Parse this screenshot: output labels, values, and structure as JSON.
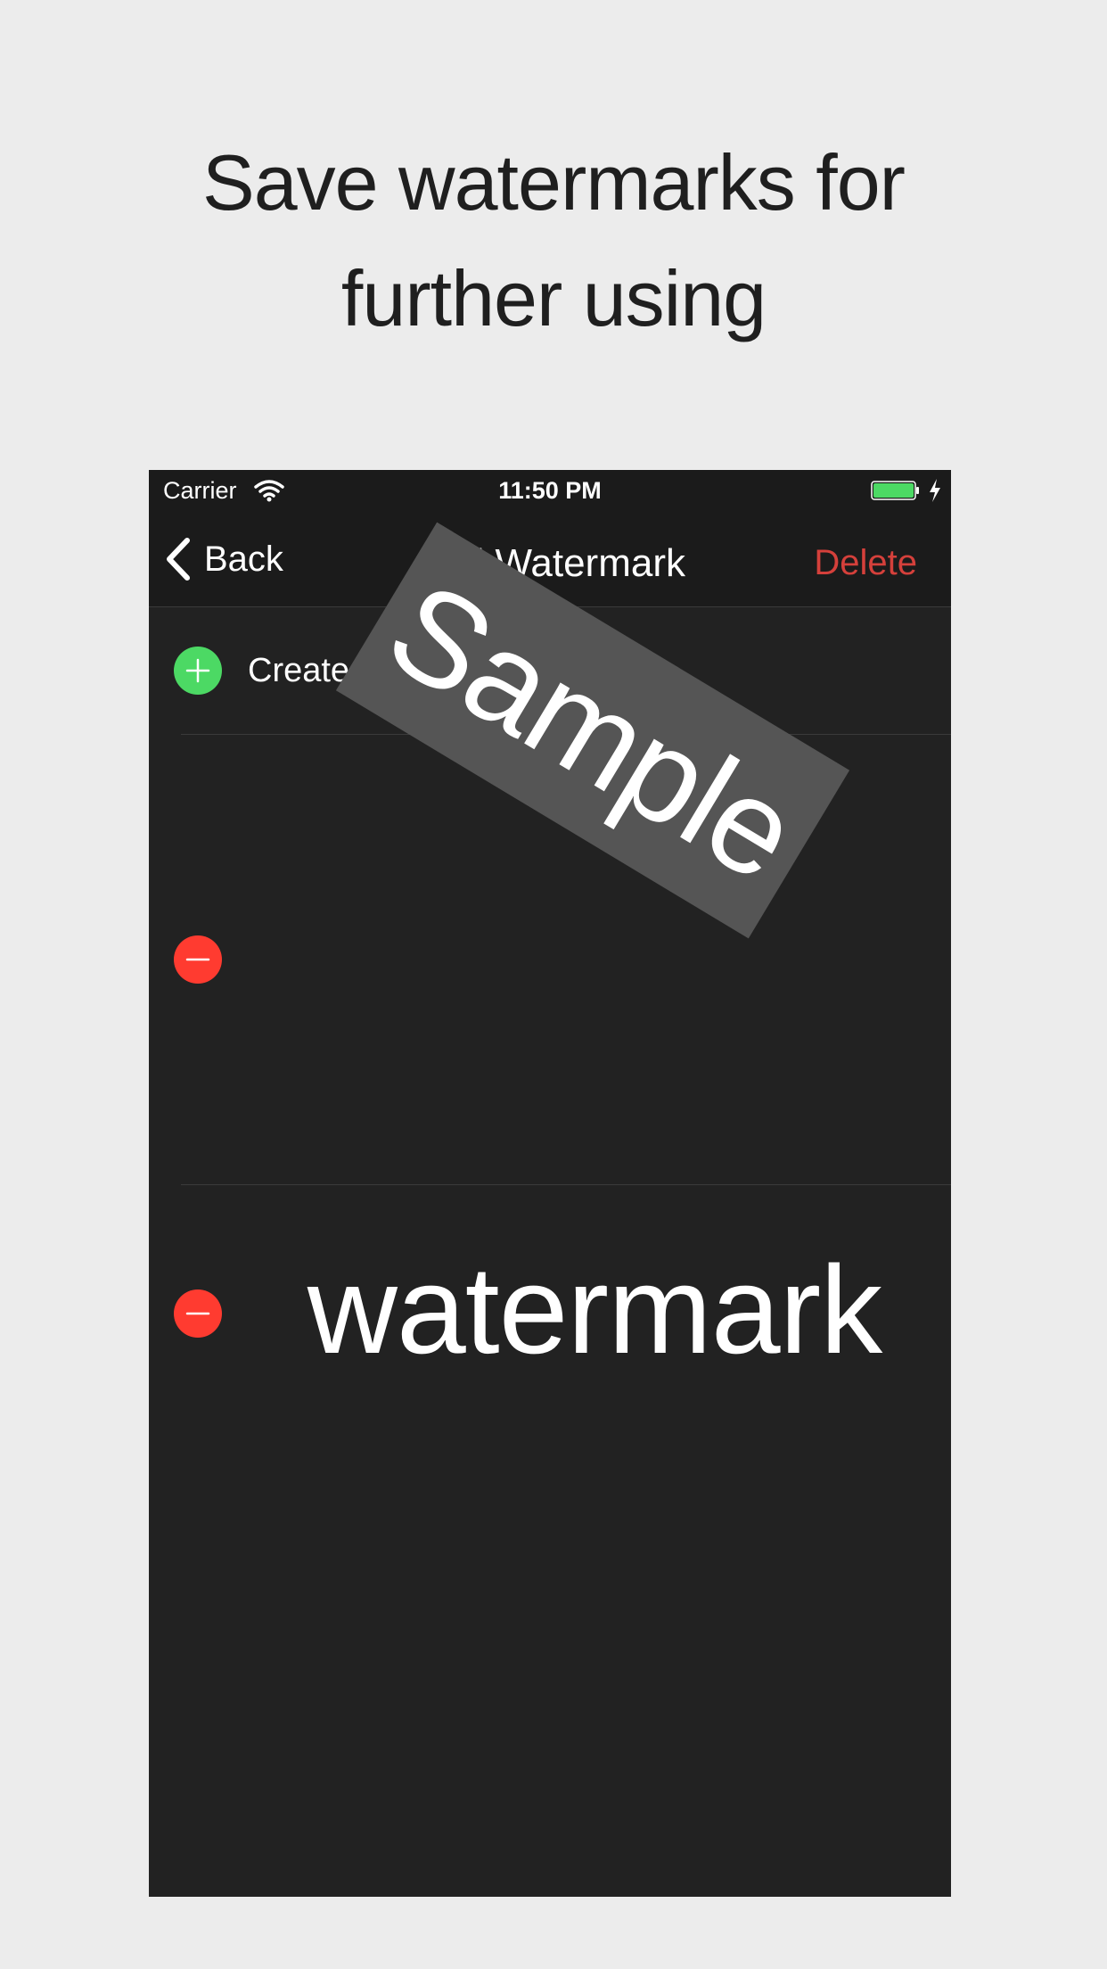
{
  "headline": {
    "line1": "Save watermarks for",
    "line2": "further using"
  },
  "status_bar": {
    "carrier": "Carrier",
    "time": "11:50 PM",
    "battery_color": "#4cd964"
  },
  "nav": {
    "back_label": "Back",
    "title": "Add Watermark",
    "delete_label": "Delete",
    "delete_color": "#d5403b"
  },
  "list": {
    "create_label": "Create Watermark",
    "items": [
      {
        "preview_text": "Sample",
        "style": "rotated-box",
        "box_color": "#555555"
      },
      {
        "preview_text": "watermark",
        "style": "plain"
      }
    ]
  },
  "colors": {
    "add": "#4cd964",
    "remove": "#ff3b30",
    "background": "#ececec",
    "screen": "#222222"
  }
}
